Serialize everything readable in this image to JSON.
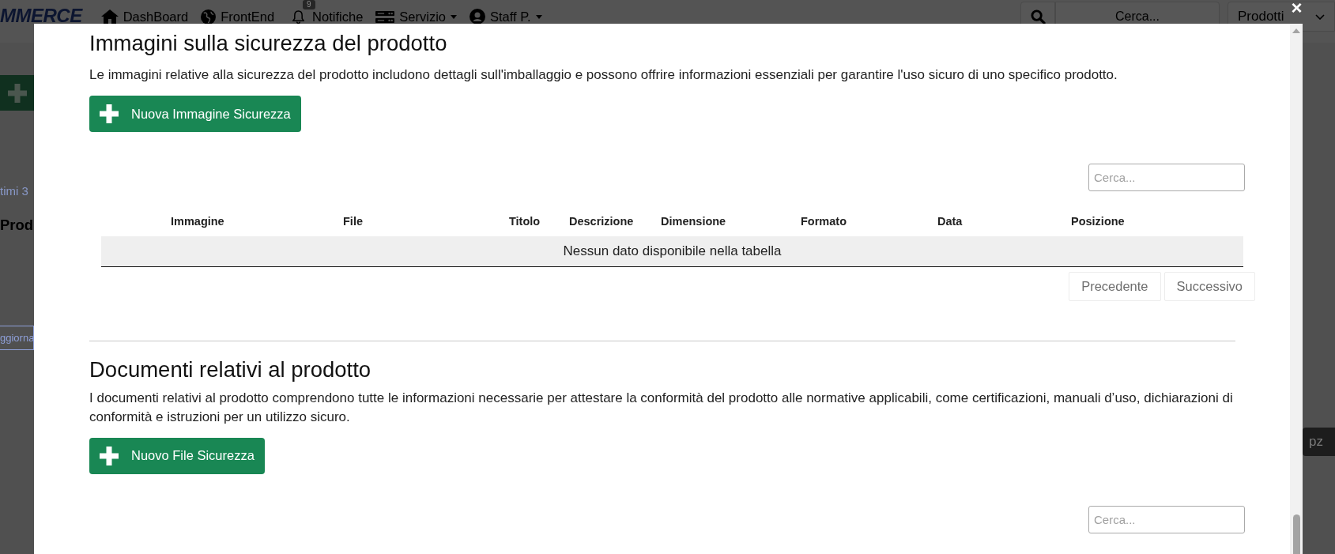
{
  "page_behind": {
    "navbar": {
      "logo": "MMERCE",
      "items": [
        {
          "label": "DashBoard",
          "dropdown": false
        },
        {
          "label": "FrontEnd",
          "dropdown": false
        },
        {
          "label": "Notifiche",
          "badge": "9",
          "dropdown": false
        },
        {
          "label": "Servizio",
          "dropdown": true
        },
        {
          "label": "Staff P.",
          "dropdown": true
        }
      ],
      "search": {
        "placeholder": "Cerca..."
      },
      "select": {
        "value": "Prodotti"
      }
    },
    "left_edge": [
      {
        "kind": "link",
        "text": "timi 3"
      },
      {
        "kind": "heading",
        "text": "Prod"
      },
      {
        "kind": "outline-button",
        "text": "ggiorna"
      }
    ],
    "right_edge": [
      {
        "kind": "badge",
        "text": "pz"
      }
    ]
  },
  "modal": {
    "close": "×",
    "sections": [
      {
        "title": "Immagini sulla sicurezza del prodotto",
        "description": "Le immagini relative alla sicurezza del prodotto includono dettagli sull'imballaggio e possono offrire informazioni essenziali per garantire l'uso sicuro di uno specifico prodotto.",
        "button": "Nuova Immagine Sicurezza",
        "search": {
          "placeholder": "Cerca..."
        },
        "table": {
          "columns": [
            "Immagine",
            "File",
            "Titolo",
            "Descrizione",
            "Dimensione",
            "Formato",
            "Data",
            "Posizione"
          ],
          "empty_message": "Nessun dato disponibile nella tabella"
        },
        "pagination": [
          {
            "label": "Precedente",
            "disabled": true
          },
          {
            "label": "Successivo",
            "disabled": true
          }
        ]
      },
      {
        "title": "Documenti relativi al prodotto",
        "description": "I documenti relativi al prodotto comprendono tutte le informazioni necessarie per attestare la conformità del prodotto alle normative applicabili, come certificazioni, manuali d’uso, dichiarazioni di conformità e istruzioni per un utilizzo sicuro.",
        "button": "Nuovo File Sicurezza",
        "search": {
          "placeholder": "Cerca..."
        }
      }
    ]
  }
}
